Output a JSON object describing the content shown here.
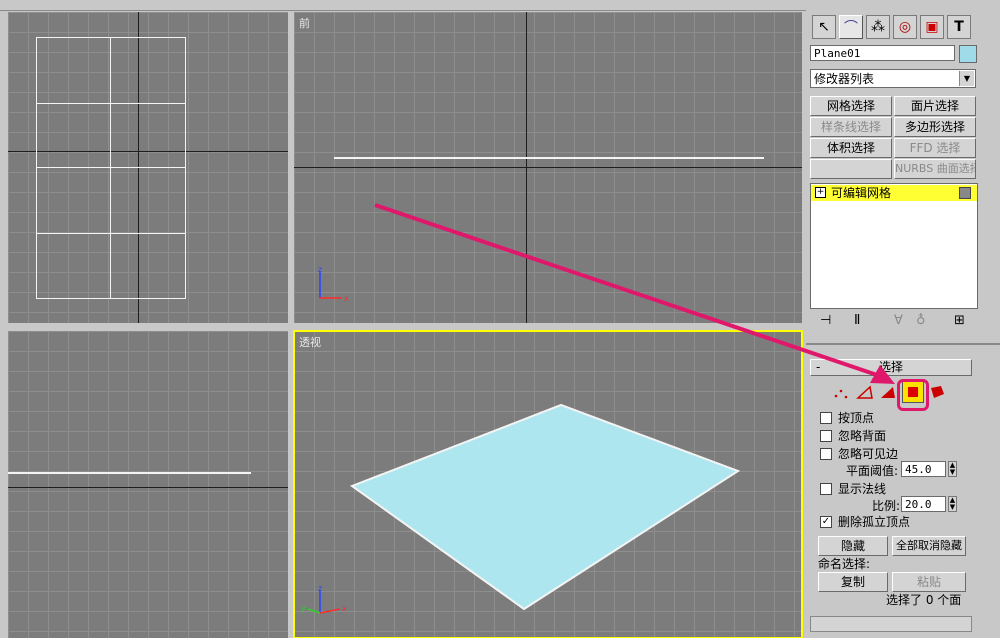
{
  "viewports": {
    "front_label": "前",
    "perspective_label": "透视"
  },
  "command_panel": {
    "object_name": "Plane01",
    "object_color": "#9fdbe8",
    "modifier_list": "修改器列表",
    "modifier_buttons": {
      "mesh_select": "网格选择",
      "patch_select": "面片选择",
      "spline_select": "样条线选择",
      "poly_select": "多边形选择",
      "volume_select": "体积选择",
      "ffd_select": "FFD 选择",
      "blank": "",
      "nurbs_select": "NURBS 曲面选择"
    },
    "stack_item": "可编辑网格",
    "stack_plus": "+",
    "rollout_minus": "-",
    "rollout_title": "选择",
    "by_vertex": "按顶点",
    "ignore_backfacing": "忽略背面",
    "ignore_visible_edges": "忽略可见边",
    "planar_threshold_label": "平面阈值:",
    "planar_threshold_value": "45.0",
    "show_normals": "显示法线",
    "scale_label": "比例:",
    "scale_value": "20.0",
    "delete_isolated_vertices": "删除孤立顶点",
    "delete_isolated_checked": true,
    "hide_button": "隐藏",
    "unhide_all_button": "全部取消隐藏",
    "named_selection_label": "命名选择:",
    "copy_button": "复制",
    "paste_button": "粘贴",
    "selection_status": "选择了 0 个面"
  },
  "colors": {
    "viewport_bg": "#7c7c7c",
    "active_border": "#ffff00",
    "arrow": "#e0186c",
    "plane_fill": "#aee6ef",
    "stack_highlight": "#ffff33"
  }
}
